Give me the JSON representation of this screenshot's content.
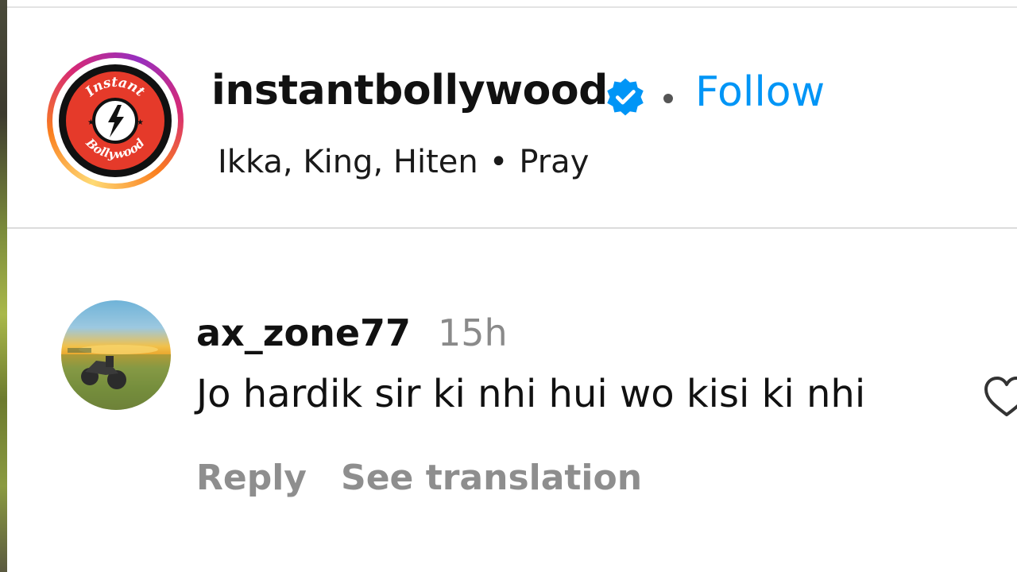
{
  "post": {
    "username": "instantbollywood",
    "verified": true,
    "follow_label": "Follow",
    "audio": {
      "artists": "Ikka, King, Hiten",
      "separator": "•",
      "track": "Pray"
    },
    "avatar": {
      "logo_top_text": "Instant",
      "logo_bottom_text": "Bollywood",
      "colors": {
        "ring_start": "#feda75",
        "ring_mid": "#d62976",
        "ring_end": "#962fbf",
        "logo_red": "#e53a2a"
      }
    }
  },
  "comment": {
    "username": "ax_zone77",
    "time": "15h",
    "text": "Jo hardik sir ki nhi hui wo kisi ki nhi",
    "reply_label": "Reply",
    "translate_label": "See translation",
    "like_icon": "heart-outline-icon"
  },
  "colors": {
    "accent": "#0095f6",
    "secondary_text": "#8e8e8e"
  }
}
